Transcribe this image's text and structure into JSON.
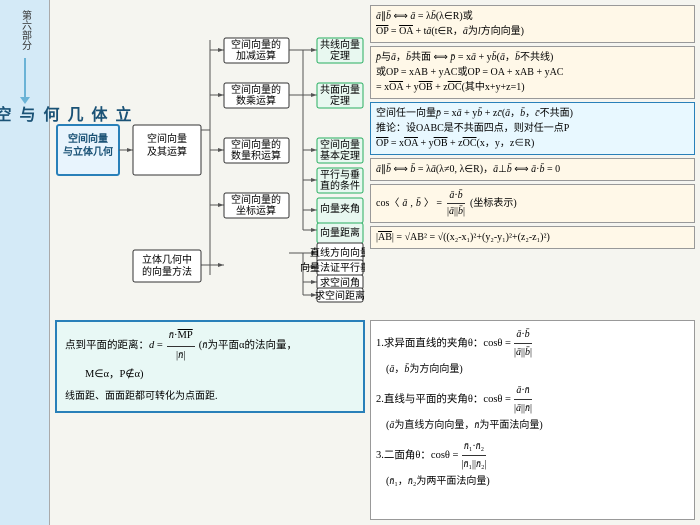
{
  "sidebar": {
    "part_label": "第六部分",
    "main_title": "立体几何与空间向量",
    "sub_title": "空间向量与立体几何"
  },
  "diagram": {
    "nodes": {
      "root": "空间向量\n及其运算",
      "n1": "空间向量的\n加减运算",
      "n2": "空间向量的\n数乘运算",
      "n3": "空间向量的\n数量积运算",
      "n4": "空间向量的\n坐标运算",
      "right_root": "空间向量\n基本定理",
      "r1": "共线向量\n定理",
      "r2": "共面向量\n定理",
      "r3": "平行与垂\n直的条件",
      "r4": "向量夹角",
      "r5": "向量距离",
      "b_root": "立体几何中\n的向量方法",
      "b1": "直线的方向向量与法向量",
      "b2": "向量法证两直线平行与垂直",
      "b3": "求空间角",
      "b4": "求空间距离"
    }
  },
  "formulas": {
    "f1_title": "共线向量定理",
    "f1": "a∥b ⟺ a = λb (λ∈R)或",
    "f1b": "OP = OA + tā (t∈R, ā为l方向向量)",
    "f2_title": "共面向量定理",
    "f2": "p̄与ā, b̄共面 ⟺ p̄ = xā + yb̄(ā, b̄不共线)",
    "f2b": "或OP = xAB + yAC或OP = OA + xAB + yAC",
    "f2c": "= xOA + yOB + zOC(其中x+y+z=1)",
    "f3": "空间任一向量p̄ = xā + yb̄ + zc̄(ā, b̄, c̄不共面)",
    "f3b": "推论：设OABC是不共面四点，则对任一点P",
    "f3c": "OP = xOA + yOB + zOC(x, y, z∈R)",
    "f4": "ā∥b̄ ⟺ b̄ = λā(λ≠0, λ∈R), ā⊥b̄ ⟺ ā·b̄ = 0",
    "f5": "cos⟨ā,b̄⟩ = (ā·b̄)/(|ā||b̄|) (坐标表示)",
    "f6": "|AB| = √AB² = √((x₂-x₁)²+(y₂-y₁)²+(z₂-z₁)²)",
    "bottom_dist": "点到平面的距离：d = (n̄·MP̄)/|n̄| (n̄为平面α的法向量, M∈α, P∉α)",
    "bottom_line": "线面距、面面距都可转化为点面距.",
    "right1": "1.求异面直线的夹角θ: cosθ = |ā·b̄|/(|ā||b̄|)",
    "right1b": "(ā, b̄为方向向量)",
    "right2": "2.直线与平面的夹角θ: cosθ = |ā·n̄|/(|ā||n̄|)",
    "right2b": "(ā为直线方向向量, n̄为平面法向量)",
    "right3": "3.二面角θ: cosθ = (n̄₁·n̄₂)/(|n̄₁||n̄₂|)",
    "right3b": "(n̄₁, n̄₂为两平面法向量)"
  },
  "colors": {
    "blue": "#2980b9",
    "light_blue": "#e8f4fd",
    "green": "#27ae60",
    "sidebar_bg": "#d4eaf7",
    "accent": "#e8f8f5"
  }
}
